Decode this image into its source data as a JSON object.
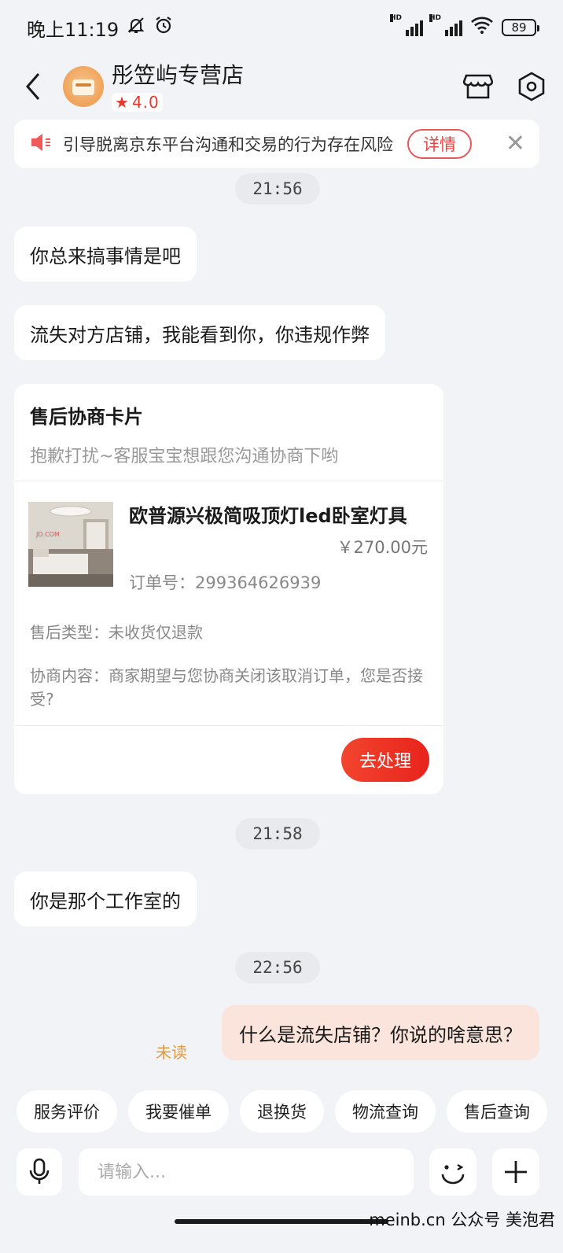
{
  "status_bar": {
    "time": "晚上11:19",
    "hd1": "HD",
    "hd2": "HD",
    "battery": "89"
  },
  "header": {
    "shop_name": "彤笠屿专营店",
    "rating_star": "★",
    "rating": "4.0"
  },
  "notice": {
    "text": "引导脱离京东平台沟通和交易的行为存在风险",
    "detail_label": "详情",
    "close_symbol": "✕"
  },
  "messages": {
    "time1": "21:56",
    "msg1": "你总来搞事情是吧",
    "msg2": "流失对方店铺，我能看到你，你违规作弊",
    "time2": "21:58",
    "msg3": "你是那个工作室的",
    "time3": "22:56",
    "msg4": "什么是流失店铺？你说的啥意思？",
    "msg4_status": "未读"
  },
  "card": {
    "title": "售后协商卡片",
    "subtitle": "抱歉打扰~客服宝宝想跟您沟通协商下哟",
    "product_name": "欧普源兴极简吸顶灯led卧室灯具",
    "price": "￥270.00元",
    "order_no": "订单号：299364626939",
    "after_sale_type": "售后类型：未收货仅退款",
    "negotiate": "协商内容：商家期望与您协商关闭该取消订单，您是否接受?",
    "image_watermark": "JD.COM",
    "process_label": "去处理"
  },
  "quick_actions": [
    "服务评价",
    "我要催单",
    "退换货",
    "物流查询",
    "售后查询"
  ],
  "input": {
    "placeholder": "请输入..."
  },
  "watermark": "meinb.cn  公众号 美泡君",
  "colors": {
    "accent": "#e8231c",
    "rating": "#e8372f",
    "unread": "#e39a3c",
    "self_bubble": "#fbe4dc",
    "background": "#f2f3f7"
  }
}
